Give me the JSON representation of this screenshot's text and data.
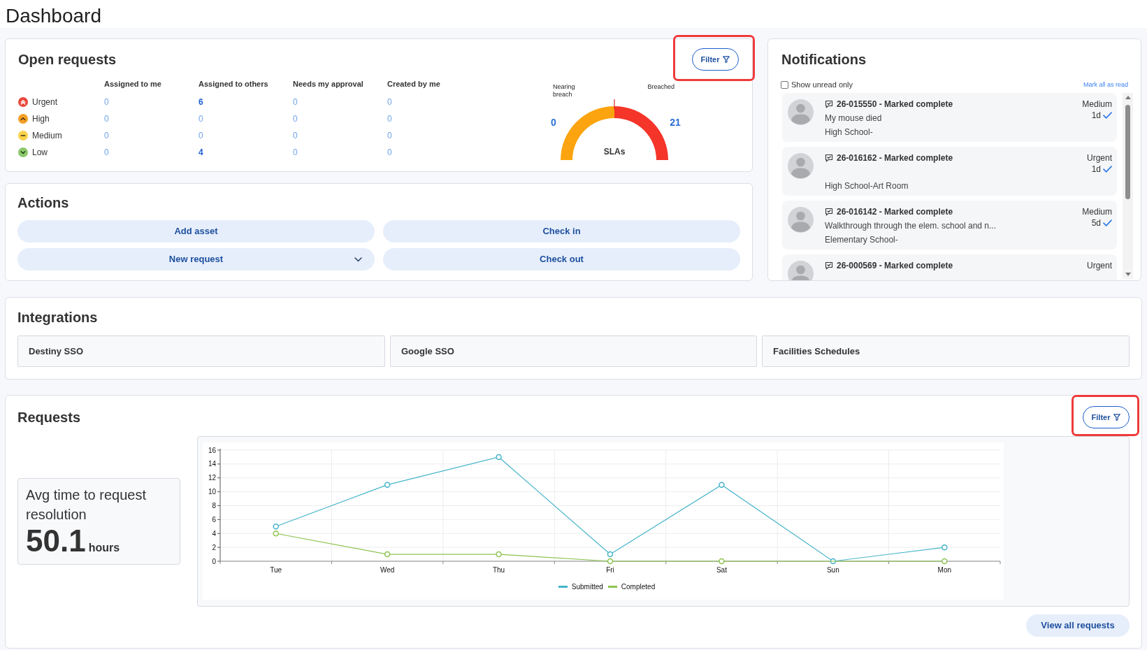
{
  "page_title": "Dashboard",
  "open_requests": {
    "title": "Open requests",
    "filter_button": {
      "label": "Filter",
      "highlighted": true
    },
    "columns": [
      "Assigned to me",
      "Assigned to others",
      "Needs my approval",
      "Created by me"
    ],
    "rows": [
      {
        "priority": "Urgent",
        "kind": "urgent",
        "color": "#e8483c",
        "counts": [
          {
            "value": "0",
            "strong": false
          },
          {
            "value": "6",
            "strong": true
          },
          {
            "value": "0",
            "strong": false
          },
          {
            "value": "0",
            "strong": false
          }
        ]
      },
      {
        "priority": "High",
        "kind": "high",
        "color": "#f5a024",
        "counts": [
          {
            "value": "0",
            "strong": false
          },
          {
            "value": "0",
            "strong": false
          },
          {
            "value": "0",
            "strong": false
          },
          {
            "value": "0",
            "strong": false
          }
        ]
      },
      {
        "priority": "Medium",
        "kind": "medium",
        "color": "#f8d24a",
        "counts": [
          {
            "value": "0",
            "strong": false
          },
          {
            "value": "0",
            "strong": false
          },
          {
            "value": "0",
            "strong": false
          },
          {
            "value": "0",
            "strong": false
          }
        ]
      },
      {
        "priority": "Low",
        "kind": "low",
        "color": "#8cc86c",
        "counts": [
          {
            "value": "0",
            "strong": false
          },
          {
            "value": "4",
            "strong": true
          },
          {
            "value": "0",
            "strong": false
          },
          {
            "value": "0",
            "strong": false
          }
        ]
      }
    ],
    "sla_gauge": {
      "nearing_label": "Nearing breach",
      "breached_label": "Breached",
      "nearing_count": "0",
      "breached_count": "21",
      "title": "SLAs"
    }
  },
  "actions": {
    "title": "Actions",
    "buttons": [
      {
        "label": "Add asset",
        "dropdown": false
      },
      {
        "label": "Check in",
        "dropdown": false
      },
      {
        "label": "New request",
        "dropdown": true
      },
      {
        "label": "Check out",
        "dropdown": false
      }
    ]
  },
  "notifications": {
    "title": "Notifications",
    "show_unread_only": {
      "label": "Show unread only",
      "checked": false
    },
    "mark_all_read": "Mark all as read",
    "items": [
      {
        "title": "26-015550 - Marked complete",
        "description": "My mouse died",
        "location": "High School-",
        "priority": "Medium",
        "age": "1d"
      },
      {
        "title": "26-016162 - Marked complete",
        "location": "High School-Art Room",
        "priority": "Urgent",
        "age": "1d"
      },
      {
        "title": "26-016142 - Marked complete",
        "description": "Walkthrough through the elem. school and n...",
        "location": "Elementary School-",
        "priority": "Medium",
        "age": "5d"
      },
      {
        "title": "26-000569 - Marked complete",
        "priority": "Urgent"
      }
    ]
  },
  "integrations": {
    "title": "Integrations",
    "items": [
      "Destiny SSO",
      "Google SSO",
      "Facilities Schedules"
    ]
  },
  "requests": {
    "title": "Requests",
    "filter_button": {
      "label": "Filter",
      "highlighted": true
    },
    "avg_resolution": {
      "label": "Avg time to request resolution",
      "value": "50.1",
      "unit": "hours"
    },
    "chart_data": {
      "type": "line",
      "categories": [
        "Tue",
        "Wed",
        "Thu",
        "Fri",
        "Sat",
        "Sun",
        "Mon"
      ],
      "series": [
        {
          "name": "Submitted",
          "color": "#45b4c9",
          "marker": "circle",
          "values": [
            5,
            11,
            15,
            1,
            11,
            0,
            2
          ]
        },
        {
          "name": "Completed",
          "color": "#8cc34f",
          "marker": "circle",
          "values": [
            4,
            1,
            1,
            0,
            0,
            0,
            0
          ]
        }
      ],
      "ylim": [
        0,
        16
      ],
      "yticks": [
        {
          "value": 0,
          "label": "0"
        },
        {
          "value": 2,
          "label": "2"
        },
        {
          "value": 4,
          "label": "4"
        },
        {
          "value": 6,
          "label": "6"
        },
        {
          "value": 8,
          "label": "8"
        },
        {
          "value": 10,
          "label": "10"
        },
        {
          "value": 12,
          "label": "12"
        },
        {
          "value": 14,
          "label": "14"
        },
        {
          "value": 16,
          "label": "16"
        }
      ],
      "grid": true,
      "legend": true
    },
    "view_all_button": "View all requests"
  }
}
